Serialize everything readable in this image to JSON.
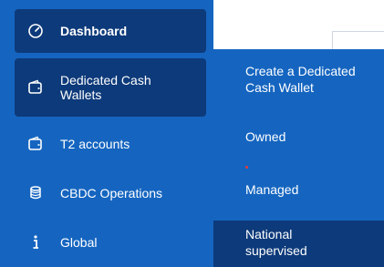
{
  "sidebar": {
    "items": [
      {
        "label": "Dashboard",
        "icon": "gauge-icon"
      },
      {
        "label": "Dedicated Cash Wallets",
        "icon": "wallet-icon"
      },
      {
        "label": "T2 accounts",
        "icon": "wallet-icon"
      },
      {
        "label": "CBDC Operations",
        "icon": "coins-icon"
      },
      {
        "label": "Global",
        "icon": "info-icon"
      }
    ]
  },
  "submenu": {
    "items": [
      {
        "label": "Create a Dedicated Cash Wallet"
      },
      {
        "label": "Owned"
      },
      {
        "label": "Managed"
      },
      {
        "label": "National supervised"
      }
    ]
  },
  "colors": {
    "sidebar_bg": "#1565c0",
    "active_bg": "#0d3a7a",
    "text": "#ffffff",
    "accent_dot": "#e23b3b"
  }
}
